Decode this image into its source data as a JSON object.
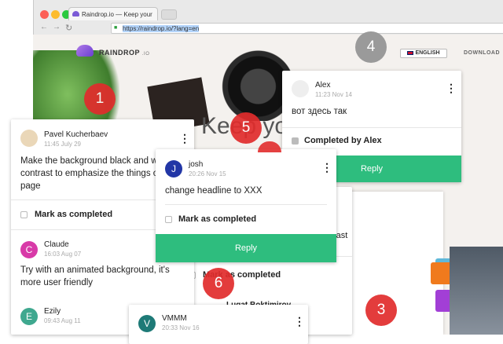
{
  "browser": {
    "tab_title": "Raindrop.io — Keep your",
    "url": "https://raindrop.io/?lang=en"
  },
  "site": {
    "logo_text": "RAINDROP",
    "logo_suffix": ".IO",
    "language": "ENGLISH",
    "download_label": "DOWNLOAD",
    "headline_fragment": "Keep you"
  },
  "comments": {
    "pavel": {
      "name": "Pavel Kucherbaev",
      "time": "11:45 July 29",
      "text": "Make the background black and with low contrast to emphasize the things on the page",
      "mark_label": "Mark as completed"
    },
    "claude": {
      "avatar": "C",
      "name": "Claude",
      "time": "16:03 Aug 07",
      "text": "Try with an animated background, it's more user friendly",
      "avatar_color": "#d83aa8"
    },
    "ezily": {
      "avatar": "E",
      "name": "Ezily",
      "time": "09:43 Aug 11",
      "avatar_color": "#3fa88f"
    },
    "alex": {
      "name": "Alex",
      "time": "11:23 Nov 14",
      "text": "вот здесь так",
      "completed_label": "Completed by Alex",
      "reply_label": "Reply"
    },
    "josh": {
      "avatar": "J",
      "name": "josh",
      "time": "20:26 Nov 15",
      "text": "change headline to XXX",
      "mark_label": "Mark as completed",
      "reply_label": "Reply",
      "avatar_color": "#2236a6"
    },
    "back_card": {
      "mark_label": "Mark as completed",
      "name_fragment": "Lugat Boktimirov",
      "text_fragment": "rast"
    },
    "vmmm": {
      "avatar": "V",
      "name": "VMMM",
      "time": "20:33 Nov 16",
      "avatar_color": "#1e7a77"
    }
  },
  "badges": {
    "b1": "1",
    "b3": "3",
    "b4": "4",
    "b5": "5",
    "b6": "6"
  },
  "colors": {
    "accent_green": "#2ebd7e",
    "badge_red": "#e12c2c",
    "badge_grey": "#9a9a9a"
  }
}
